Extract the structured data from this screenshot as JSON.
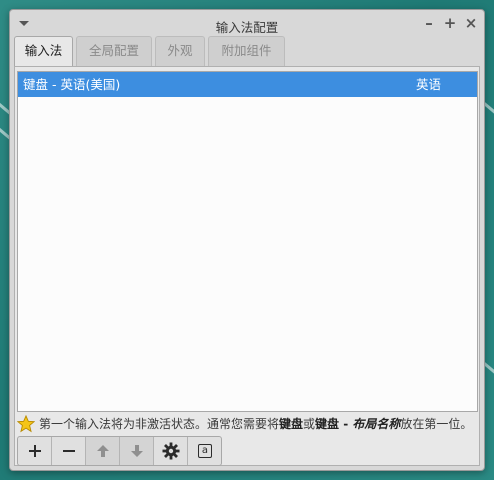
{
  "window": {
    "title": "输入法配置",
    "controls": {
      "minimize": "–",
      "maximize": "+",
      "close": "×"
    }
  },
  "tabs": [
    {
      "label": "输入法",
      "active": true
    },
    {
      "label": "全局配置",
      "active": false
    },
    {
      "label": "外观",
      "active": false
    },
    {
      "label": "附加组件",
      "active": false
    }
  ],
  "input_methods": [
    {
      "name": "键盘 - 英语(美国)",
      "language": "英语",
      "selected": true
    }
  ],
  "hint": {
    "icon": "star-icon",
    "prefix": "第一个输入法将为非激活状态。通常您需要将",
    "bold1": "键盘",
    "mid": "或",
    "bold2a": "键盘 - ",
    "bold2b": "布局名称",
    "suffix": "放在第一位。"
  },
  "toolbar": [
    {
      "name": "add-button",
      "icon": "plus-icon",
      "enabled": true
    },
    {
      "name": "remove-button",
      "icon": "minus-icon",
      "enabled": true
    },
    {
      "name": "move-up-button",
      "icon": "arrow-up-icon",
      "enabled": false
    },
    {
      "name": "move-down-button",
      "icon": "arrow-down-icon",
      "enabled": false
    },
    {
      "name": "configure-button",
      "icon": "gear-icon",
      "enabled": true
    },
    {
      "name": "keyboard-layout-button",
      "icon": "keyboard-layout-icon",
      "label": "a",
      "enabled": true
    }
  ],
  "colors": {
    "selection": "#3d8ee0",
    "desktop": "#2a8a84"
  }
}
